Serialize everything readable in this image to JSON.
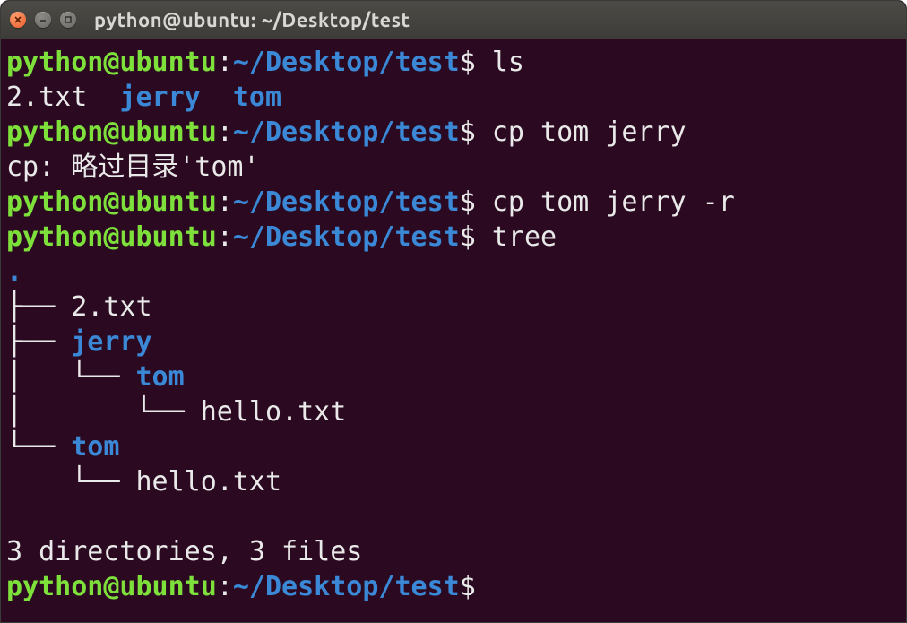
{
  "window": {
    "title": "python@ubuntu: ~/Desktop/test"
  },
  "prompt": {
    "user_host": "python@ubuntu",
    "colon": ":",
    "path": "~/Desktop/test",
    "sigil": "$"
  },
  "session": {
    "cmd1": "ls",
    "ls_output_file": "2.txt",
    "ls_output_dir1": "jerry",
    "ls_output_dir2": "tom",
    "cmd2": "cp tom jerry",
    "cp_msg_prefix": "cp: 略过目录",
    "cp_msg_target": "'tom'",
    "cmd3": "cp tom jerry -r",
    "cmd4": "tree",
    "tree_root": ".",
    "tree_l1a_prefix": "├── ",
    "tree_l1a_name": "2.txt",
    "tree_l1b_prefix": "├── ",
    "tree_l1b_name": "jerry",
    "tree_l2a_prefix": "│   └── ",
    "tree_l2a_name": "tom",
    "tree_l3a_prefix": "│       └── ",
    "tree_l3a_name": "hello.txt",
    "tree_l1c_prefix": "└── ",
    "tree_l1c_name": "tom",
    "tree_l2b_prefix": "    └── ",
    "tree_l2b_name": "hello.txt",
    "tree_summary": "3 directories, 3 files"
  }
}
